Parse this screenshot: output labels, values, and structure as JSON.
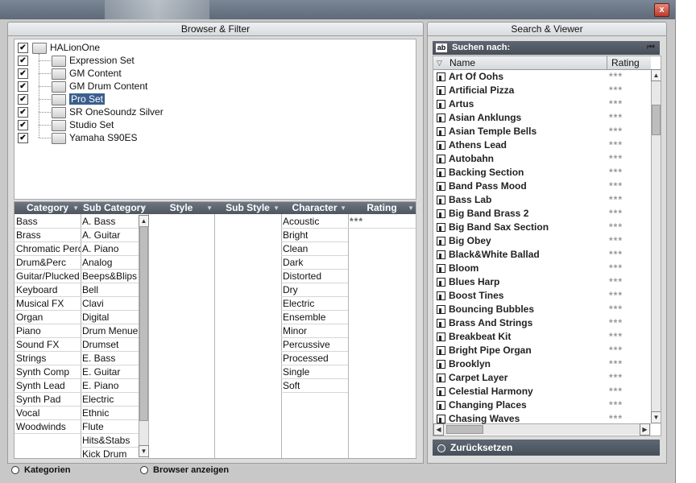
{
  "window": {
    "close_glyph": "x"
  },
  "browser": {
    "title": "Browser & Filter",
    "tree": {
      "root": {
        "label": "HALionOne",
        "checked": true
      },
      "children": [
        {
          "label": "Expression Set",
          "checked": true
        },
        {
          "label": "GM Content",
          "checked": true
        },
        {
          "label": "GM Drum Content",
          "checked": true
        },
        {
          "label": "Pro Set",
          "checked": true,
          "selected": true
        },
        {
          "label": "SR OneSoundz Silver",
          "checked": true
        },
        {
          "label": "Studio Set",
          "checked": true
        },
        {
          "label": "Yamaha S90ES",
          "checked": true
        }
      ]
    },
    "filter": {
      "columns": [
        {
          "name": "Category",
          "items": [
            "Bass",
            "Brass",
            "Chromatic Perc",
            "Drum&Perc",
            "Guitar/Plucked",
            "Keyboard",
            "Musical FX",
            "Organ",
            "Piano",
            "Sound FX",
            "Strings",
            "Synth Comp",
            "Synth Lead",
            "Synth Pad",
            "Vocal",
            "Woodwinds"
          ]
        },
        {
          "name": "Sub Category",
          "items": [
            "A. Bass",
            "A. Guitar",
            "A. Piano",
            "Analog",
            "Beeps&Blips",
            "Bell",
            "Clavi",
            "Digital",
            "Drum Menues",
            "Drumset",
            "E. Bass",
            "E. Guitar",
            "E. Piano",
            "Electric",
            "Ethnic",
            "Flute",
            "Hits&Stabs",
            "Kick Drum"
          ]
        },
        {
          "name": "Style",
          "items": []
        },
        {
          "name": "Sub Style",
          "items": []
        },
        {
          "name": "Character",
          "items": [
            "Acoustic",
            "Bright",
            "Clean",
            "Dark",
            "Distorted",
            "Dry",
            "Electric",
            "Ensemble",
            "Minor",
            "Percussive",
            "Processed",
            "Single",
            "Soft"
          ]
        },
        {
          "name": "Rating",
          "items": [
            "***"
          ]
        }
      ]
    },
    "options": {
      "categories_label": "Kategorien",
      "show_browser_label": "Browser anzeigen"
    }
  },
  "viewer": {
    "title": "Search & Viewer",
    "search_label": "Suchen nach:",
    "columns": {
      "name": "Name",
      "rating": "Rating"
    },
    "results": [
      {
        "name": "Art Of Oohs",
        "rating": "***"
      },
      {
        "name": "Artificial Pizza",
        "rating": "***"
      },
      {
        "name": "Artus",
        "rating": "***"
      },
      {
        "name": "Asian Anklungs",
        "rating": "***"
      },
      {
        "name": "Asian Temple Bells",
        "rating": "***"
      },
      {
        "name": "Athens Lead",
        "rating": "***"
      },
      {
        "name": "Autobahn",
        "rating": "***"
      },
      {
        "name": "Backing Section",
        "rating": "***"
      },
      {
        "name": "Band Pass Mood",
        "rating": "***"
      },
      {
        "name": "Bass Lab",
        "rating": "***"
      },
      {
        "name": "Big Band Brass 2",
        "rating": "***"
      },
      {
        "name": "Big Band Sax Section",
        "rating": "***"
      },
      {
        "name": "Big Obey",
        "rating": "***"
      },
      {
        "name": "Black&White Ballad",
        "rating": "***"
      },
      {
        "name": "Bloom",
        "rating": "***"
      },
      {
        "name": "Blues Harp",
        "rating": "***"
      },
      {
        "name": "Boost Tines",
        "rating": "***"
      },
      {
        "name": "Bouncing Bubbles",
        "rating": "***"
      },
      {
        "name": "Brass And Strings",
        "rating": "***"
      },
      {
        "name": "Breakbeat Kit",
        "rating": "***"
      },
      {
        "name": "Bright Pipe Organ",
        "rating": "***"
      },
      {
        "name": "Brooklyn",
        "rating": "***"
      },
      {
        "name": "Carpet Layer",
        "rating": "***"
      },
      {
        "name": "Celestial Harmony",
        "rating": "***"
      },
      {
        "name": "Changing Places",
        "rating": "***"
      },
      {
        "name": "Chasing Waves",
        "rating": "***"
      }
    ],
    "reset_label": "Zurücksetzen"
  }
}
